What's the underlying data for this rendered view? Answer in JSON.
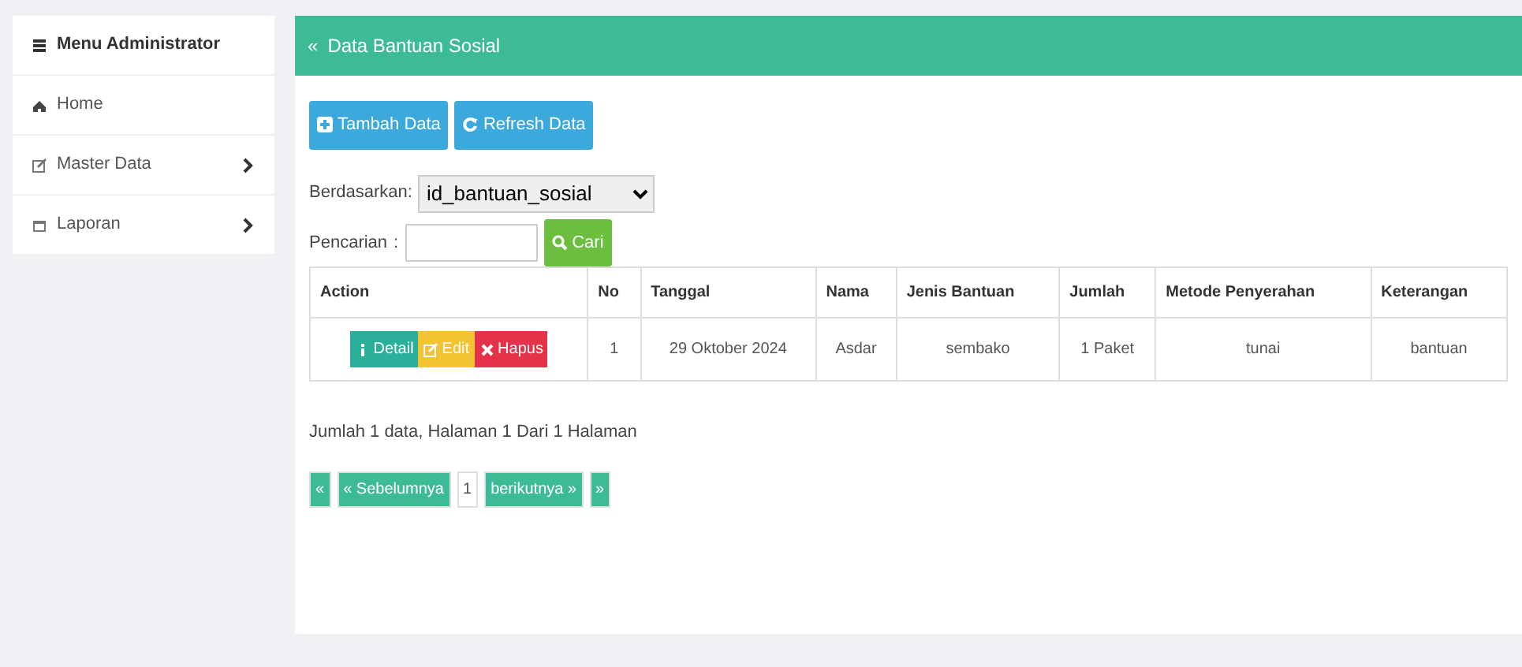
{
  "sidebar": {
    "title": "Menu Administrator",
    "items": [
      {
        "label": "Home",
        "has_submenu": false
      },
      {
        "label": "Master Data",
        "has_submenu": true
      },
      {
        "label": "Laporan",
        "has_submenu": true
      }
    ]
  },
  "panel": {
    "back_icon": "«",
    "title": "Data Bantuan Sosial"
  },
  "toolbar": [
    {
      "label": "Tambah Data",
      "kind": "add"
    },
    {
      "label": "Refresh Data",
      "kind": "refresh"
    }
  ],
  "filter": {
    "label": "Berdasarkan:",
    "value": "id_bantuan_sosial"
  },
  "search": {
    "label": "Pencarian",
    "separator": ":",
    "button": "Cari"
  },
  "table": {
    "columns": [
      "Action",
      "No",
      "Tanggal",
      "Nama",
      "Jenis Bantuan",
      "Jumlah",
      "Metode Penyerahan",
      "Keterangan"
    ],
    "rows": [
      [
        {
          "actions": [
            {
              "kind": "detail",
              "label": "Detail"
            },
            {
              "kind": "edit",
              "label": "Edit"
            },
            {
              "kind": "delete",
              "label": "Hapus"
            }
          ]
        },
        "1",
        "29 Oktober 2024",
        "Asdar",
        "sembako",
        "1 Paket",
        "tunai",
        "bantuan"
      ]
    ]
  },
  "summary": "Jumlah 1 data, Halaman 1 Dari 1 Halaman",
  "pagination": [
    {
      "label": "«",
      "selected": false
    },
    {
      "label": "« Sebelumnya",
      "selected": false
    },
    {
      "label": "1",
      "selected": true
    },
    {
      "label": "berikutnya »",
      "selected": false
    },
    {
      "label": "»",
      "selected": false
    }
  ]
}
